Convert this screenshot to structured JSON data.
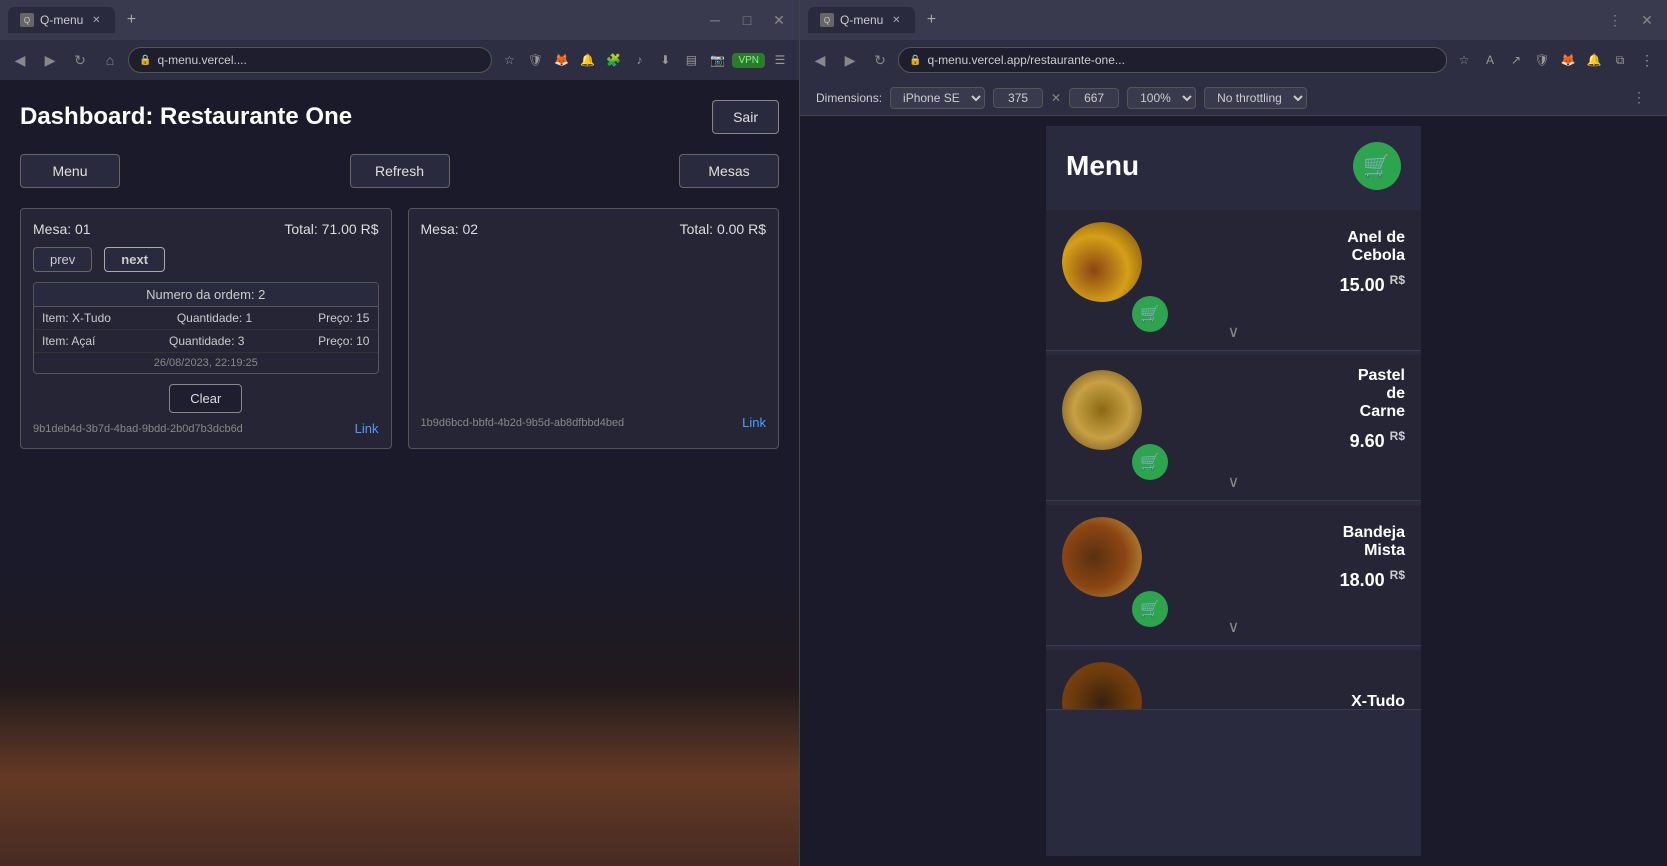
{
  "left_browser": {
    "tab_title": "Q-menu",
    "address": "q-menu.vercel....",
    "dashboard_title": "Dashboard: Restaurante One",
    "sair_label": "Sair",
    "menu_label": "Menu",
    "refresh_label": "Refresh",
    "mesas_label": "Mesas",
    "table1": {
      "mesa": "Mesa: 01",
      "total": "Total: 71.00 R$",
      "prev": "prev",
      "next": "next",
      "order_header": "Numero da ordem: 2",
      "items": [
        {
          "name": "Item: X-Tudo",
          "qty": "Quantidade: 1",
          "price": "Preço: 15"
        },
        {
          "name": "Item: Açaí",
          "qty": "Quantidade: 3",
          "price": "Preço: 10"
        }
      ],
      "timestamp": "26/08/2023, 22:19:25",
      "clear_label": "Clear",
      "id": "9b1deb4d-3b7d-4bad-9bdd-2b0d7b3dcb6d",
      "link": "Link"
    },
    "table2": {
      "mesa": "Mesa: 02",
      "total": "Total: 0.00 R$",
      "id": "1b9d6bcd-bbfd-4b2d-9b5d-ab8dfbbd4bed",
      "link": "Link"
    }
  },
  "right_browser": {
    "tab_title": "Q-menu",
    "address": "q-menu.vercel.app/restaurante-one...",
    "dimensions_device": "iPhone SE",
    "dim_width": "375",
    "dim_height": "667",
    "zoom": "100%",
    "throttling": "No throttling",
    "menu": {
      "title": "Menu",
      "cart_icon": "🛒",
      "items": [
        {
          "name": "Anel de\nCebola",
          "price": "15.00",
          "currency": "R$"
        },
        {
          "name": "Pastel\nde\nCarne",
          "price": "9.60",
          "currency": "R$"
        },
        {
          "name": "Bandeja\nMista",
          "price": "18.00",
          "currency": "R$"
        },
        {
          "name": "X-Tudo",
          "price": "",
          "currency": ""
        }
      ]
    }
  }
}
